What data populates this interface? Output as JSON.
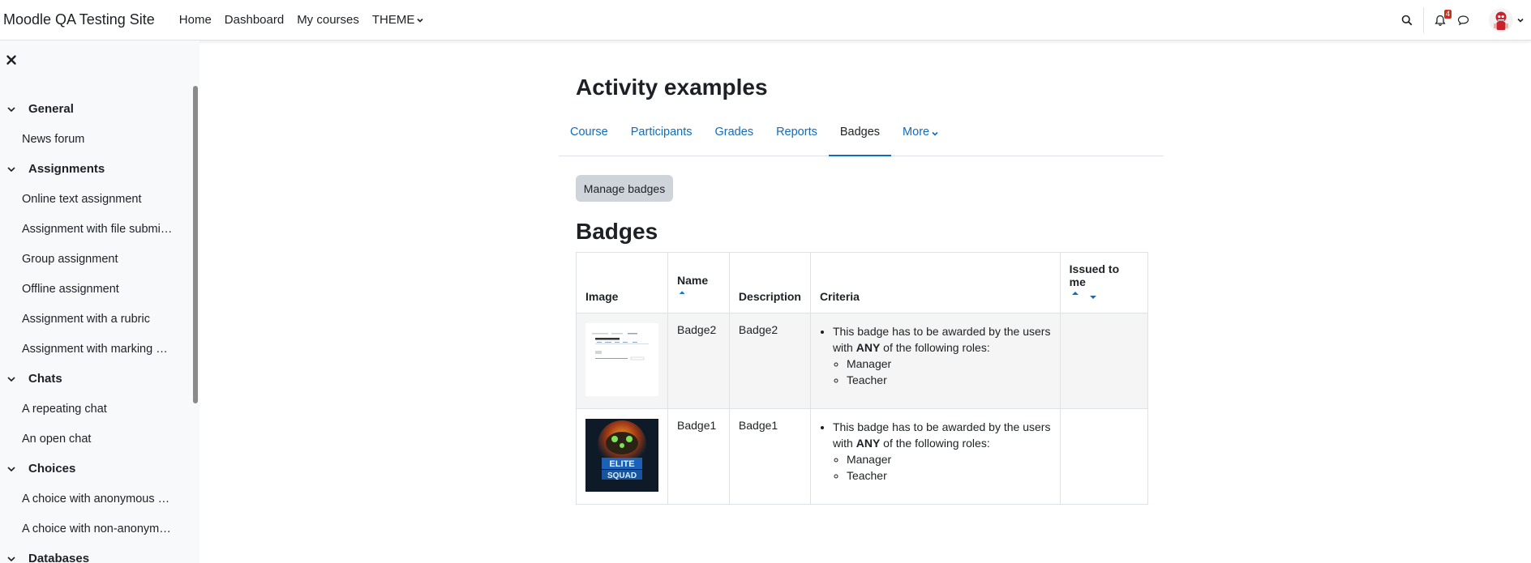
{
  "navbar": {
    "site_name": "Moodle QA Testing Site",
    "links": [
      "Home",
      "Dashboard",
      "My courses"
    ],
    "theme_label": "THEME",
    "notification_count": "4",
    "icons": [
      "search-icon",
      "bell-icon",
      "chat-icon",
      "avatar",
      "chevron-down-icon"
    ]
  },
  "drawer": {
    "close_icon": "close-icon",
    "sections": [
      {
        "title": "General",
        "items": [
          "News forum"
        ]
      },
      {
        "title": "Assignments",
        "items": [
          "Online text assignment",
          "Assignment with file submi…",
          "Group assignment",
          "Offline assignment",
          "Assignment with a rubric",
          "Assignment with marking …"
        ]
      },
      {
        "title": "Chats",
        "items": [
          "A repeating chat",
          "An open chat"
        ]
      },
      {
        "title": "Choices",
        "items": [
          "A choice with anonymous …",
          "A choice with non-anonym…"
        ]
      },
      {
        "title": "Databases",
        "items": []
      }
    ]
  },
  "main": {
    "title": "Activity examples",
    "tabs": [
      "Course",
      "Participants",
      "Grades",
      "Reports",
      "Badges",
      "More"
    ],
    "active_tab": "Badges",
    "manage_button": "Manage badges",
    "badges_heading": "Badges",
    "table": {
      "headers": [
        "Image",
        "Name",
        "Description",
        "Criteria",
        "Issued to me"
      ],
      "rows": [
        {
          "name": "Badge2",
          "description": "Badge2",
          "criteria_intro_1": "This badge has to be awarded by the users with ",
          "criteria_bold": "ANY",
          "criteria_intro_2": " of the following roles:",
          "roles": [
            "Manager",
            "Teacher"
          ],
          "issued": ""
        },
        {
          "name": "Badge1",
          "description": "Badge1",
          "criteria_intro_1": "This badge has to be awarded by the users with ",
          "criteria_bold": "ANY",
          "criteria_intro_2": " of the following roles:",
          "roles": [
            "Manager",
            "Teacher"
          ],
          "issued": ""
        }
      ]
    }
  },
  "colors": {
    "link": "#0f6cbf",
    "drawer_bg": "#f8f9fa",
    "button_bg": "#ced4da",
    "notification_badge": "#ca3120"
  }
}
